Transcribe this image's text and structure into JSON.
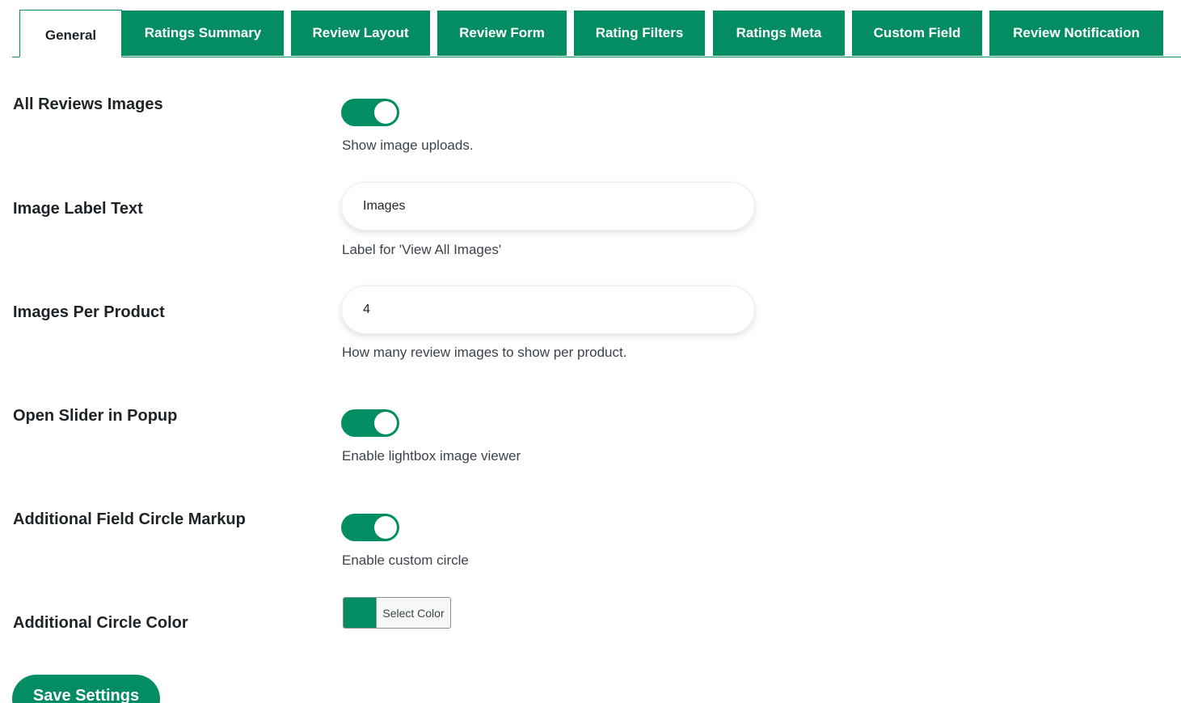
{
  "tabs": [
    {
      "label": "General",
      "active": true
    },
    {
      "label": "Ratings Summary"
    },
    {
      "label": "Review Layout"
    },
    {
      "label": "Review Form"
    },
    {
      "label": "Rating Filters"
    },
    {
      "label": "Ratings Meta"
    },
    {
      "label": "Custom Field"
    },
    {
      "label": "Review Notification"
    }
  ],
  "settings": {
    "all_reviews_images": {
      "label": "All Reviews Images",
      "enabled": true,
      "description": "Show image uploads."
    },
    "image_label_text": {
      "label": "Image Label Text",
      "value": "Images",
      "description": "Label for 'View All Images'"
    },
    "images_per_product": {
      "label": "Images Per Product",
      "value": "4",
      "description": "How many review images to show per product."
    },
    "open_slider_popup": {
      "label": "Open Slider in Popup",
      "enabled": true,
      "description": "Enable lightbox image viewer"
    },
    "additional_field_circle": {
      "label": "Additional Field Circle Markup",
      "enabled": true,
      "description": "Enable custom circle"
    },
    "additional_circle_color": {
      "label": "Additional Circle Color",
      "color": "#048c63",
      "button_label": "Select Color"
    }
  },
  "save_button": "Save Settings",
  "colors": {
    "accent": "#048c63",
    "text": "#1d2327",
    "muted": "#3c434a"
  }
}
